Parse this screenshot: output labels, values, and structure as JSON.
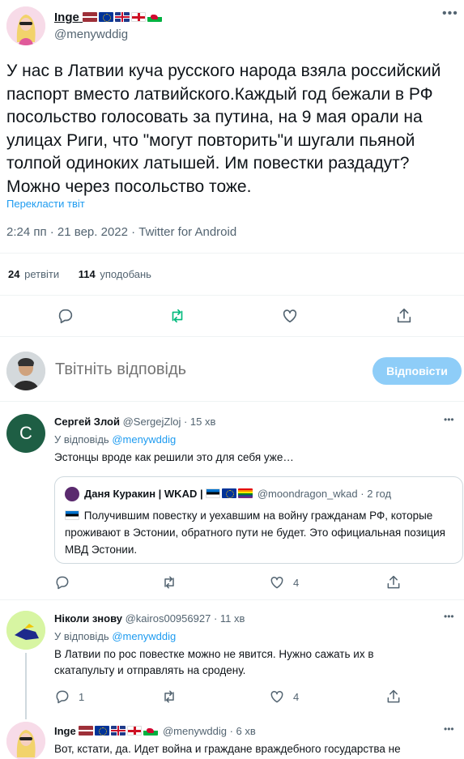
{
  "main_tweet": {
    "author_name": "Inge",
    "author_flags": [
      "flag-lv",
      "flag-eu",
      "flag-uk",
      "flag-en",
      "flag-wa"
    ],
    "handle": "@menywddig",
    "text": "У нас в Латвии куча русского народа взяла российский паспорт вместо латвийского.Каждый год бежали в РФ посольство голосовать за путина, на 9 мая орали на улицах Риги, что \"могут повторить\"и шугали пьяной толпой одиноких латышей. Им повестки раздадут? Можно через посольство тоже.",
    "translate_label": "Перекласти твіт",
    "meta": "2:24 пп · 21 вер. 2022 · Twitter for Android",
    "retweets_count": "24",
    "retweets_label": "ретвіти",
    "likes_count": "114",
    "likes_label": "уподобань"
  },
  "reply_box": {
    "placeholder": "Твітніть відповідь",
    "button_label": "Відповісти"
  },
  "replies": [
    {
      "avatar_letter": "С",
      "name": "Сергей Злой",
      "handle": "@SergejZloj",
      "time": "· 15 хв",
      "replying_to_label": "У відповідь",
      "replying_to_handle": "@menywddig",
      "text": "Эстонцы вроде как решили это для себя уже…",
      "quote": {
        "name": "Даня Куракин | WKAD |",
        "handle": "@moondragon_wkad",
        "time": "· 2 год",
        "text": "Получившим повестку и уехавшим на войну гражданам РФ, которые проживают в Эстонии, обратного пути не будет. Это официальная позиция МВД Эстонии."
      },
      "reply_count": "",
      "like_count": "4"
    },
    {
      "name": "Ніколи знову",
      "handle": "@kairos00956927",
      "time": "· 11 хв",
      "replying_to_label": "У відповідь",
      "replying_to_handle": "@menywddig",
      "text": "В Латвии по рос повестке можно не явится. Нужно сажать их в скатапульту и отправлять на сродену.",
      "reply_count": "1",
      "like_count": "4"
    },
    {
      "name": "Inge",
      "handle": "@menywddig",
      "time": "· 6 хв",
      "text": "Вот, кстати, да. Идет война и граждане враждебного государства не"
    }
  ],
  "colors": {
    "accent": "#1d9bf0",
    "retweet_green": "#00ba7c",
    "muted": "#536471"
  }
}
